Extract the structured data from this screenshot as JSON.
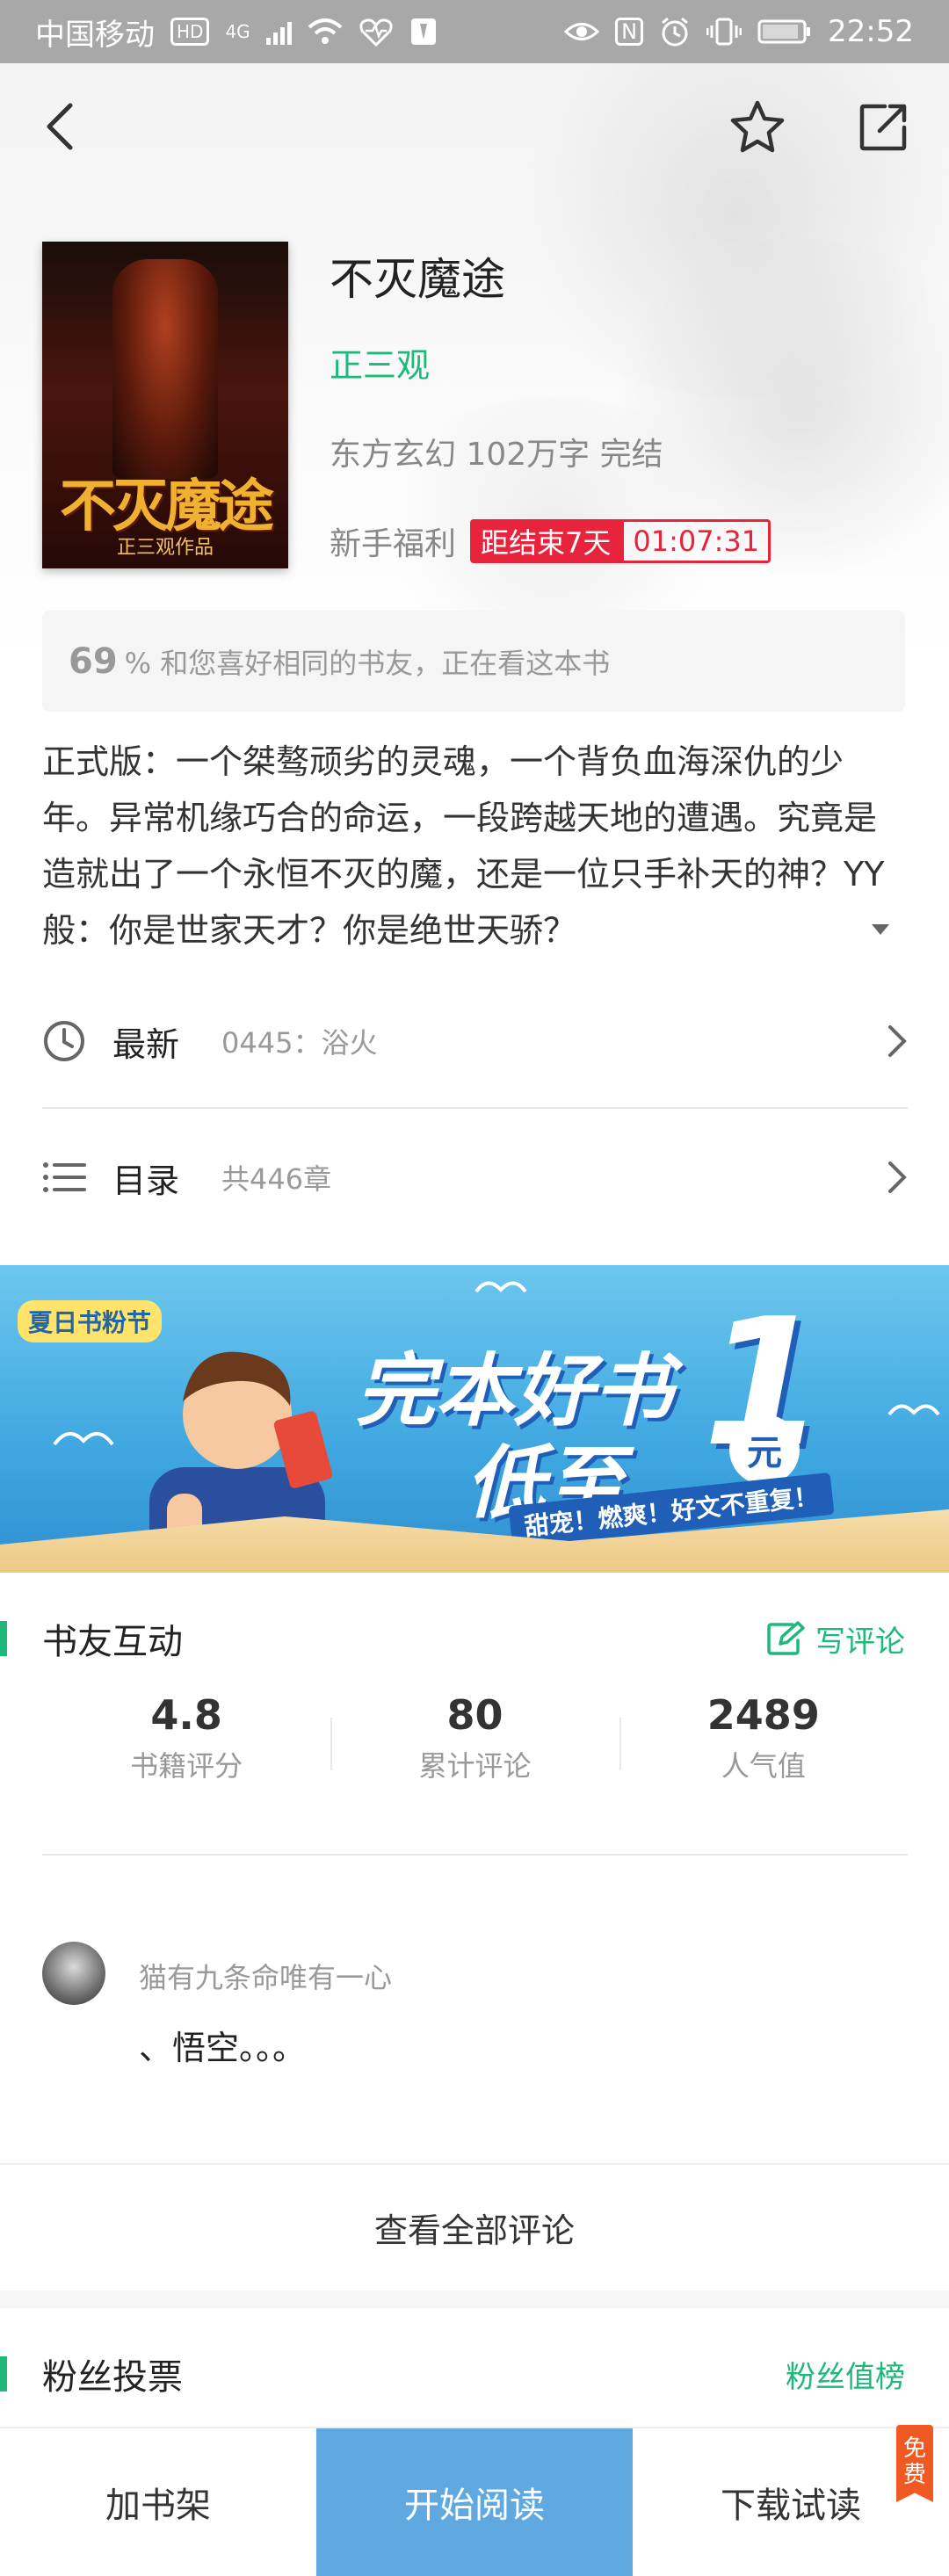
{
  "status_bar": {
    "carrier": "中国移动",
    "hd": "HD",
    "net": "4G",
    "nfc": "N",
    "time": "22:52"
  },
  "book": {
    "title": "不灭魔途",
    "author": "正三观",
    "meta": "东方玄幻 102万字 完结",
    "cover_title": "不灭魔途",
    "cover_author": "正三观作品"
  },
  "promo": {
    "label": "新手福利",
    "end_text": "距结束7天",
    "countdown": "01:07:31",
    "accent": "#e8243c"
  },
  "match": {
    "percent": "69",
    "text": "% 和您喜好相同的书友，正在看这本书"
  },
  "description": "正式版：一个桀骜顽劣的灵魂，一个背负血海深仇的少年。异常机缘巧合的命运，一段跨越天地的遭遇。究竟是造就出了一个永恒不灭的魔，还是一位只手补天的神？YY般：你是世家天才？你是绝世天骄？",
  "latest": {
    "label": "最新",
    "chapter": "0445：浴火"
  },
  "toc": {
    "label": "目录",
    "count": "共446章"
  },
  "banner": {
    "tag": "夏日书粉节",
    "line1": "完本好书",
    "line2": "低至",
    "number": "1",
    "unit": "元",
    "slogan": "甜宠！燃爽！好文不重复！"
  },
  "interaction": {
    "title": "书友互动",
    "write_review": "写评论",
    "stats": [
      {
        "value": "4.8",
        "label": "书籍评分"
      },
      {
        "value": "80",
        "label": "累计评论"
      },
      {
        "value": "2489",
        "label": "人气值"
      }
    ],
    "comment": {
      "user": "猫有九条命唯有一心",
      "text": "、悟空。。。"
    },
    "view_all": "查看全部评论"
  },
  "fans": {
    "title": "粉丝投票",
    "rank": "粉丝值榜"
  },
  "bottom": {
    "add_shelf": "加书架",
    "start_read": "开始阅读",
    "download": "下载试读",
    "free_badge": "免费"
  },
  "colors": {
    "brand_green": "#1db87a",
    "read_button": "#5fa8e0",
    "badge_orange": "#f05a22"
  }
}
